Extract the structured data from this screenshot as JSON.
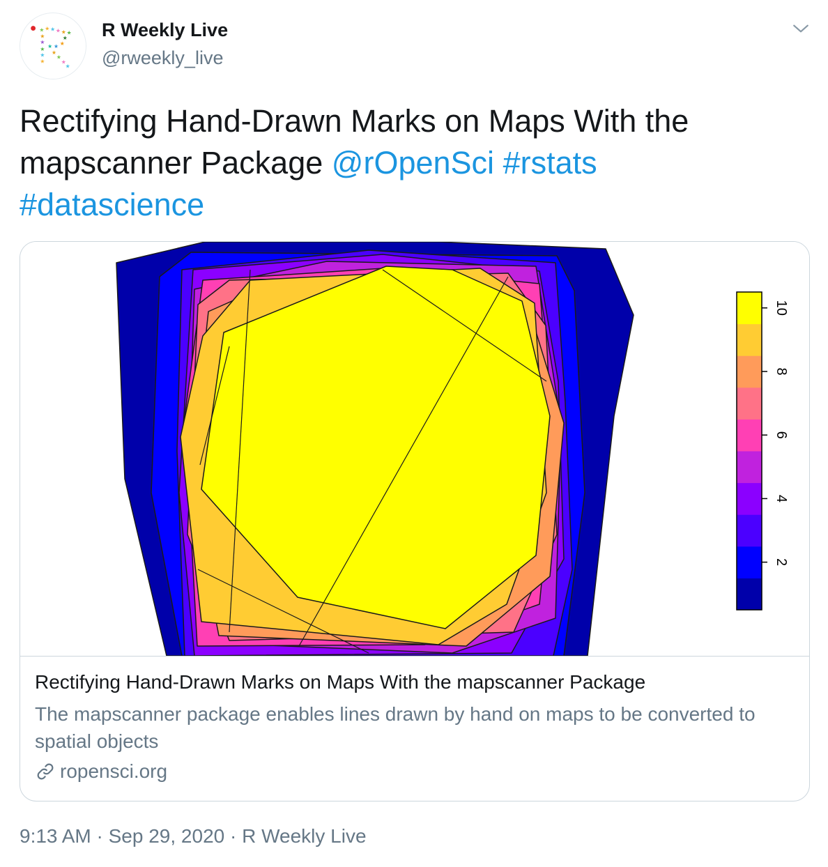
{
  "author": {
    "display_name": "R Weekly Live",
    "handle": "@rweekly_live",
    "avatar_icon": "r-weekly-logo-icon"
  },
  "menu": {
    "icon": "chevron-down-icon"
  },
  "tweet": {
    "text": "Rectifying Hand-Drawn Marks on Maps With the mapscanner Package",
    "mention": "@rOpenSci",
    "hashtags": [
      "#rstats",
      "#datascience"
    ]
  },
  "card": {
    "title": "Rectifying Hand-Drawn Marks on Maps With the mapscanner Package",
    "description": "The mapscanner package enables lines drawn by hand on maps to be converted to spatial objects",
    "domain": "ropensci.org",
    "domain_icon": "link-icon"
  },
  "chart_data": {
    "type": "heatmap",
    "legend_ticks": [
      2,
      4,
      6,
      8,
      10
    ],
    "legend_range": [
      0.5,
      10.5
    ],
    "levels": [
      1,
      2,
      3,
      4,
      5,
      6,
      7,
      8,
      9,
      10
    ],
    "colors": [
      "#0000aa",
      "#0000ff",
      "#4b00ff",
      "#8b00ff",
      "#c022de",
      "#ff40b4",
      "#ff7287",
      "#ff9b5a",
      "#ffcc33",
      "#ffff00"
    ]
  },
  "footer": {
    "time": "9:13 AM",
    "separator": "·",
    "date": "Sep 29, 2020",
    "source": "R Weekly Live"
  }
}
